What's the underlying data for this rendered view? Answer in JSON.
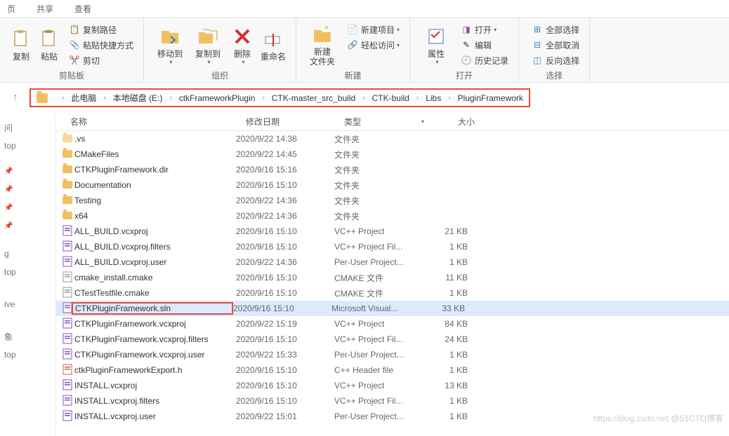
{
  "tabs": {
    "t1": "页",
    "t2": "共享",
    "t3": "查看"
  },
  "ribbon": {
    "clipboard": {
      "label": "剪贴板",
      "copy": "复制",
      "paste": "粘贴",
      "copy_path": "复制路径",
      "paste_shortcut": "粘贴快捷方式",
      "cut": "剪切"
    },
    "organize": {
      "label": "组织",
      "move_to": "移动到",
      "copy_to": "复制到",
      "delete": "删除",
      "rename": "重命名"
    },
    "new": {
      "label": "新建",
      "new_folder": "新建\n文件夹",
      "new_item": "新建项目",
      "easy_access": "轻松访问"
    },
    "open": {
      "label": "打开",
      "properties": "属性",
      "open": "打开",
      "edit": "编辑",
      "history": "历史记录"
    },
    "select": {
      "label": "选择",
      "select_all": "全部选择",
      "select_none": "全部取消",
      "invert": "反向选择"
    }
  },
  "breadcrumb": [
    "此电脑",
    "本地磁盘 (E:)",
    "ctkFrameworkPlugin",
    "CTK-master_src_build",
    "CTK-build",
    "Libs",
    "PluginFramework"
  ],
  "columns": {
    "name": "名称",
    "date": "修改日期",
    "type": "类型",
    "size": "大小"
  },
  "nav": {
    "i1": "问",
    "i2": "top",
    "i3": "g",
    "i4": "top",
    "i5": "ive",
    "i6": "象",
    "i7": "top"
  },
  "files": [
    {
      "icon": "folder-hidden",
      "name": ".vs",
      "date": "2020/9/22 14:36",
      "type": "文件夹",
      "size": ""
    },
    {
      "icon": "folder",
      "name": "CMakeFiles",
      "date": "2020/9/22 14:45",
      "type": "文件夹",
      "size": ""
    },
    {
      "icon": "folder",
      "name": "CTKPluginFramework.dir",
      "date": "2020/9/16 15:16",
      "type": "文件夹",
      "size": ""
    },
    {
      "icon": "folder",
      "name": "Documentation",
      "date": "2020/9/16 15:10",
      "type": "文件夹",
      "size": ""
    },
    {
      "icon": "folder",
      "name": "Testing",
      "date": "2020/9/22 14:36",
      "type": "文件夹",
      "size": ""
    },
    {
      "icon": "folder",
      "name": "x64",
      "date": "2020/9/22 14:36",
      "type": "文件夹",
      "size": ""
    },
    {
      "icon": "vcxproj",
      "name": "ALL_BUILD.vcxproj",
      "date": "2020/9/16 15:10",
      "type": "VC++ Project",
      "size": "21 KB"
    },
    {
      "icon": "filters",
      "name": "ALL_BUILD.vcxproj.filters",
      "date": "2020/9/16 15:10",
      "type": "VC++ Project Fil...",
      "size": "1 KB"
    },
    {
      "icon": "user",
      "name": "ALL_BUILD.vcxproj.user",
      "date": "2020/9/22 14:36",
      "type": "Per-User Project...",
      "size": "1 KB"
    },
    {
      "icon": "file",
      "name": "cmake_install.cmake",
      "date": "2020/9/16 15:10",
      "type": "CMAKE 文件",
      "size": "11 KB"
    },
    {
      "icon": "file",
      "name": "CTestTestfile.cmake",
      "date": "2020/9/16 15:10",
      "type": "CMAKE 文件",
      "size": "1 KB"
    },
    {
      "icon": "sln",
      "name": "CTKPluginFramework.sln",
      "date": "2020/9/16 15:10",
      "type": "Microsoft Visual...",
      "size": "33 KB",
      "selected": true,
      "highlight": true
    },
    {
      "icon": "vcxproj",
      "name": "CTKPluginFramework.vcxproj",
      "date": "2020/9/22 15:19",
      "type": "VC++ Project",
      "size": "84 KB"
    },
    {
      "icon": "filters",
      "name": "CTKPluginFramework.vcxproj.filters",
      "date": "2020/9/16 15:10",
      "type": "VC++ Project Fil...",
      "size": "24 KB"
    },
    {
      "icon": "user",
      "name": "CTKPluginFramework.vcxproj.user",
      "date": "2020/9/22 15:33",
      "type": "Per-User Project...",
      "size": "1 KB"
    },
    {
      "icon": "h",
      "name": "ctkPluginFrameworkExport.h",
      "date": "2020/9/16 15:10",
      "type": "C++ Header file",
      "size": "1 KB"
    },
    {
      "icon": "vcxproj",
      "name": "INSTALL.vcxproj",
      "date": "2020/9/16 15:10",
      "type": "VC++ Project",
      "size": "13 KB"
    },
    {
      "icon": "filters",
      "name": "INSTALL.vcxproj.filters",
      "date": "2020/9/16 15:10",
      "type": "VC++ Project Fil...",
      "size": "1 KB"
    },
    {
      "icon": "user",
      "name": "INSTALL.vcxproj.user",
      "date": "2020/9/22 15:01",
      "type": "Per-User Project...",
      "size": "1 KB"
    }
  ],
  "watermark": "https://blog.csdn.net @51CTO博客"
}
